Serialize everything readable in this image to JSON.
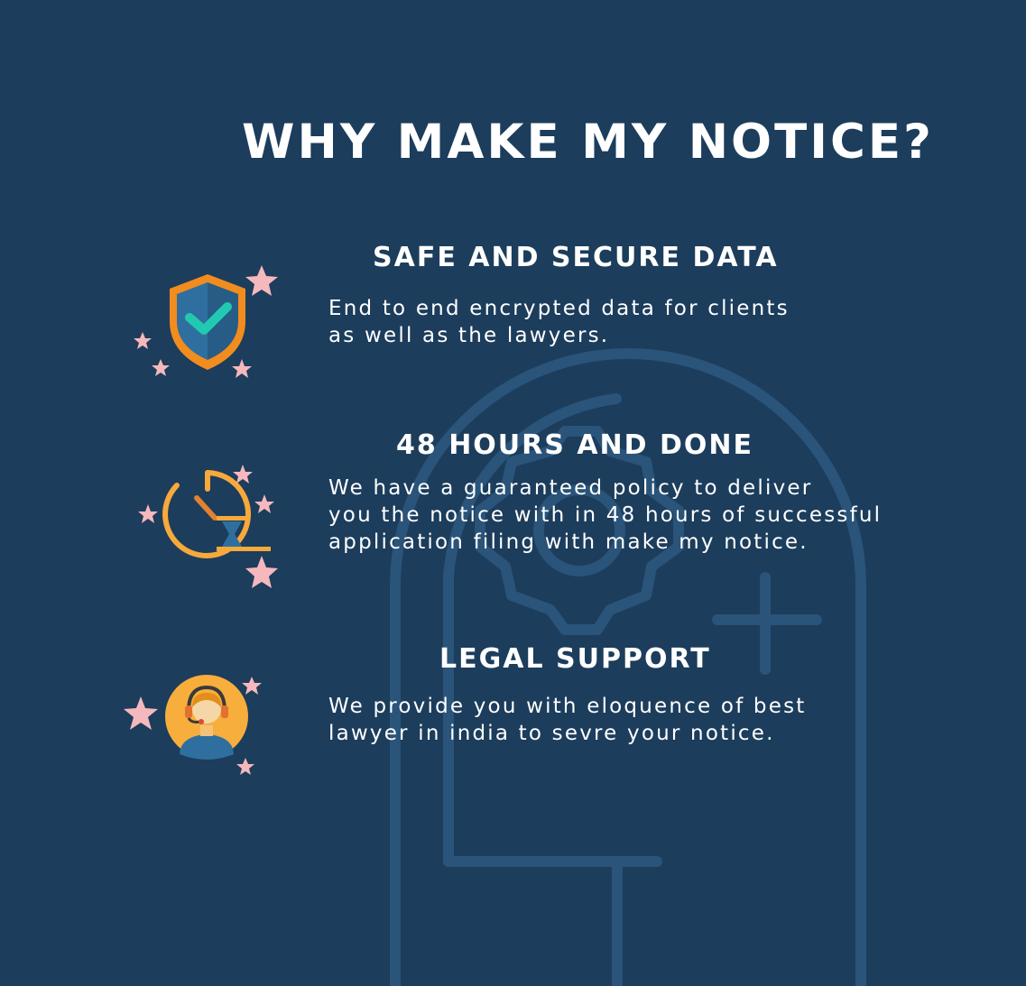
{
  "colors": {
    "background": "#1c3d5c",
    "watermark": "#2a5479",
    "star": "#f5b8bd",
    "shield_orange": "#f18c1e",
    "shield_blue": "#2f6f9f",
    "check_teal": "#22c9b1",
    "timer_orange": "#f7a93b",
    "avatar_yellow": "#f7ae3c"
  },
  "page": {
    "title": "WHY MAKE MY NOTICE?"
  },
  "features": [
    {
      "icon": "shield-check-icon",
      "title": "SAFE AND SECURE DATA",
      "lines": [
        "End to end encrypted data for clients",
        "as well as the lawyers."
      ]
    },
    {
      "icon": "stopwatch-hourglass-icon",
      "title": "48 HOURS AND DONE",
      "lines": [
        "We have a guaranteed policy to deliver",
        "you the notice with in 48 hours of successful",
        "application filing with make my notice."
      ]
    },
    {
      "icon": "support-agent-icon",
      "title": "LEGAL SUPPORT",
      "lines": [
        "We provide you with eloquence of best",
        "lawyer in india to sevre your notice."
      ]
    }
  ]
}
